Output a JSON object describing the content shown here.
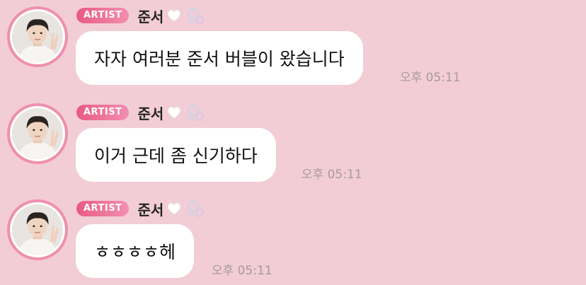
{
  "colors": {
    "background": "#f2cdd5",
    "badge": "#e85a85",
    "avatar_ring": "#ef8fae",
    "bubble": "#ffffff",
    "timestamp": "#a89aa0"
  },
  "messages": [
    {
      "badge": "ARTIST",
      "sender": "준서",
      "text": "자자 여러분 준서 버블이 왔습니다",
      "time": "오후 05:11",
      "icons": [
        "avatar",
        "white-heart-icon",
        "bubble-icon"
      ]
    },
    {
      "badge": "ARTIST",
      "sender": "준서",
      "text": "이거 근데 좀 신기하다",
      "time": "오후 05:11",
      "icons": [
        "avatar",
        "white-heart-icon",
        "bubble-icon"
      ]
    },
    {
      "badge": "ARTIST",
      "sender": "준서",
      "text": "ㅎㅎㅎㅎ헤",
      "time": "오후 05:11",
      "icons": [
        "avatar",
        "white-heart-icon",
        "bubble-icon"
      ]
    }
  ]
}
